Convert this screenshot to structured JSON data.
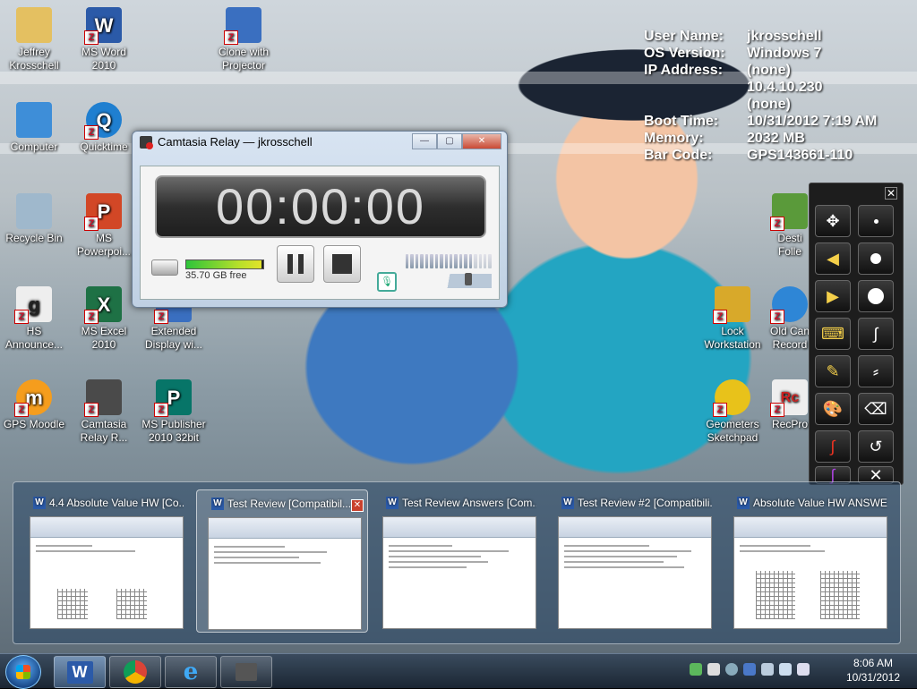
{
  "desktop": {
    "icons": [
      {
        "label": "Jeffrey Krosschell",
        "icon": "user-folder-icon"
      },
      {
        "label": "MS Word 2010",
        "icon": "word-icon"
      },
      {
        "label": "Clone with Projector",
        "icon": "display-clone-icon"
      },
      {
        "label": "Computer",
        "icon": "computer-icon"
      },
      {
        "label": "Quicktime",
        "icon": "quicktime-icon"
      },
      {
        "label": "Recycle Bin",
        "icon": "recycle-bin-icon"
      },
      {
        "label": "MS Powerpoi...",
        "icon": "powerpoint-icon"
      },
      {
        "label": "HS Announce...",
        "icon": "announcement-icon"
      },
      {
        "label": "MS Excel 2010",
        "icon": "excel-icon"
      },
      {
        "label": "Extended Display wi...",
        "icon": "display-extend-icon"
      },
      {
        "label": "GPS Moodle",
        "icon": "moodle-icon"
      },
      {
        "label": "Camtasia Relay R...",
        "icon": "camtasia-icon"
      },
      {
        "label": "MS Publisher 2010 32bit",
        "icon": "publisher-icon"
      },
      {
        "label": "Lock Workstation",
        "icon": "lock-icon"
      },
      {
        "label": "Old Can Record",
        "icon": "globe-icon"
      },
      {
        "label": "Geometers Sketchpad",
        "icon": "sketchpad-icon"
      },
      {
        "label": "RecPro",
        "icon": "recpro-icon"
      },
      {
        "label": "Desti Folle",
        "icon": "tree-folder-icon"
      }
    ]
  },
  "sysinfo": {
    "rows": [
      {
        "key": "User Name:",
        "value": "jkrosschell"
      },
      {
        "key": "OS Version:",
        "value": "Windows 7"
      },
      {
        "key": "IP Address:",
        "value": "(none)"
      },
      {
        "key": "",
        "value": "10.4.10.230"
      },
      {
        "key": "",
        "value": "(none)"
      },
      {
        "key": "Boot Time:",
        "value": "10/31/2012 7:19 AM"
      },
      {
        "key": "Memory:",
        "value": "2032 MB"
      },
      {
        "key": "Bar Code:",
        "value": "GPS143661-110"
      }
    ]
  },
  "relay": {
    "title": "Camtasia Relay — jkrosschell",
    "timer": "00:00:00",
    "disk_free": "35.70 GB free",
    "disk_used_fraction": 0.98,
    "mic_level_fraction": 0.75,
    "window_buttons": {
      "minimize": "—",
      "maximize": "▢",
      "close": "✕"
    }
  },
  "pen_toolbar": {
    "close_label": "✕"
  },
  "thumbnails": [
    {
      "title": "4.4 Absolute Value HW [Co...",
      "active": false
    },
    {
      "title": "Test Review [Compatibil...",
      "active": true
    },
    {
      "title": "Test Review Answers [Com...",
      "active": false
    },
    {
      "title": "Test Review #2 [Compatibili...",
      "active": false
    },
    {
      "title": "Absolute Value HW ANSWE...",
      "active": false
    }
  ],
  "taskbar": {
    "buttons": [
      {
        "name": "word",
        "active": true
      },
      {
        "name": "chrome",
        "active": false
      },
      {
        "name": "internet-explorer",
        "active": false
      },
      {
        "name": "camtasia-relay",
        "active": false
      }
    ],
    "time": "8:06 AM",
    "date": "10/31/2012"
  },
  "colors": {
    "taskbar": "#1b2633",
    "accent": "#2b5aa8",
    "close": "#c9412d"
  }
}
